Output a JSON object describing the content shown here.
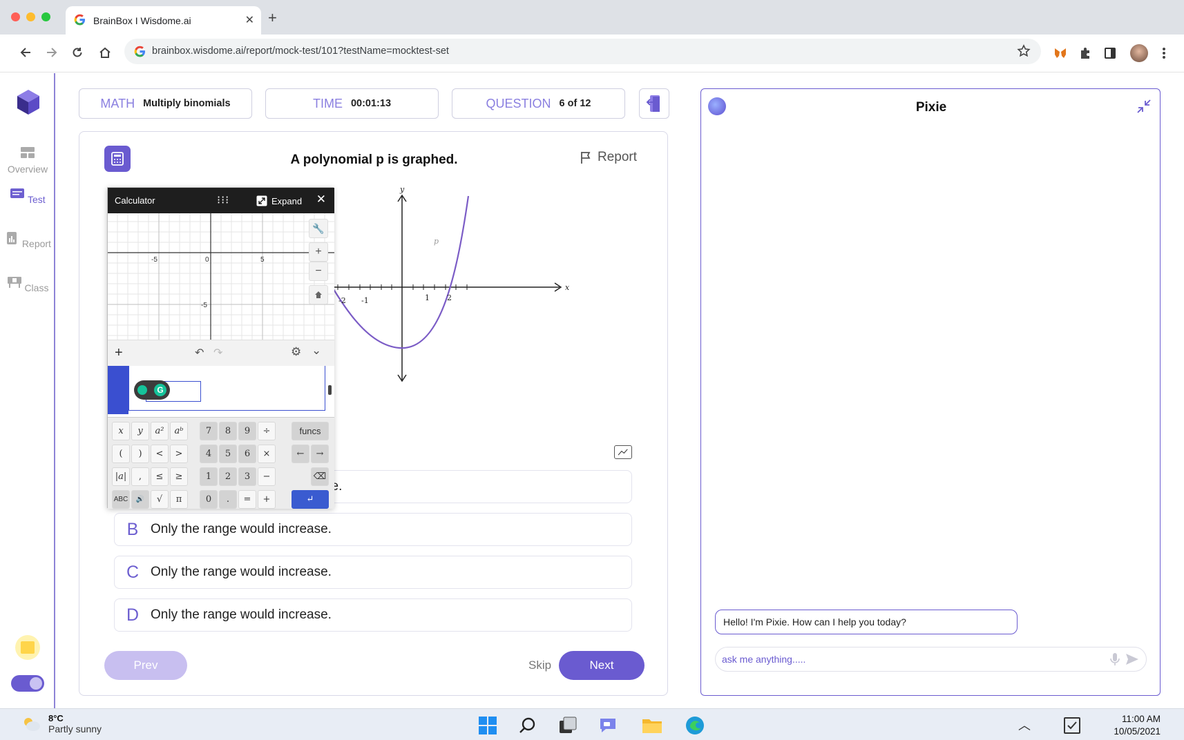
{
  "browser": {
    "tab_title": "BrainBox I Wisdome.ai",
    "url": "brainbox.wisdome.ai/report/mock-test/101?testName=mocktest-set"
  },
  "sidebar": {
    "items": [
      {
        "label": "Overview",
        "icon": "grid-icon"
      },
      {
        "label": "Test",
        "icon": "test-icon"
      },
      {
        "label": "Report",
        "icon": "report-icon"
      },
      {
        "label": "Class",
        "icon": "class-icon"
      }
    ]
  },
  "header": {
    "subject_key": "MATH",
    "subject_value": "Multiply binomials",
    "time_key": "TIME",
    "time_value": "00:01:13",
    "question_key": "QUESTION",
    "question_value": "6 of 12"
  },
  "question": {
    "title": "A polynomial p is graphed.",
    "report_label": "Report",
    "graph_labels": {
      "x": "x",
      "y": "y",
      "curve": "p",
      "ticks": [
        "-2",
        "-1",
        "1",
        "2"
      ]
    },
    "options": [
      {
        "letter": "A",
        "text": "se."
      },
      {
        "letter": "B",
        "text": "Only the range would increase."
      },
      {
        "letter": "C",
        "text": "Only the range would increase."
      },
      {
        "letter": "D",
        "text": "Only the range would increase."
      }
    ],
    "prev_label": "Prev",
    "skip_label": "Skip",
    "next_label": "Next"
  },
  "calculator": {
    "title": "Calculator",
    "expand_label": "Expand",
    "axis_ticks": [
      "-5",
      "0",
      "5",
      "-5"
    ],
    "keys_row1": [
      "x",
      "y",
      "a²",
      "aᵇ",
      "7",
      "8",
      "9",
      "÷",
      "funcs"
    ],
    "keys_row2": [
      "(",
      ")",
      "<",
      ">",
      "4",
      "5",
      "6",
      "×",
      "←",
      "→"
    ],
    "keys_row3": [
      "|a|",
      ",",
      "≤",
      "≥",
      "1",
      "2",
      "3",
      "−",
      "⌫"
    ],
    "keys_row4": [
      "ABC",
      "🔊",
      "√",
      "π",
      "0",
      ".",
      "=",
      "+",
      "↵"
    ]
  },
  "pixie": {
    "name": "Pixie",
    "greeting": "Hello! I'm Pixie. How can I help you today?",
    "input_placeholder": "ask me anything....."
  },
  "taskbar": {
    "temp": "8°C",
    "weather": "Partly sunny",
    "time": "11:00 AM",
    "date": "10/05/2021"
  },
  "colors": {
    "accent": "#6a5bd0",
    "accent_light": "#c8bff0",
    "curve": "#7b5cc6"
  }
}
